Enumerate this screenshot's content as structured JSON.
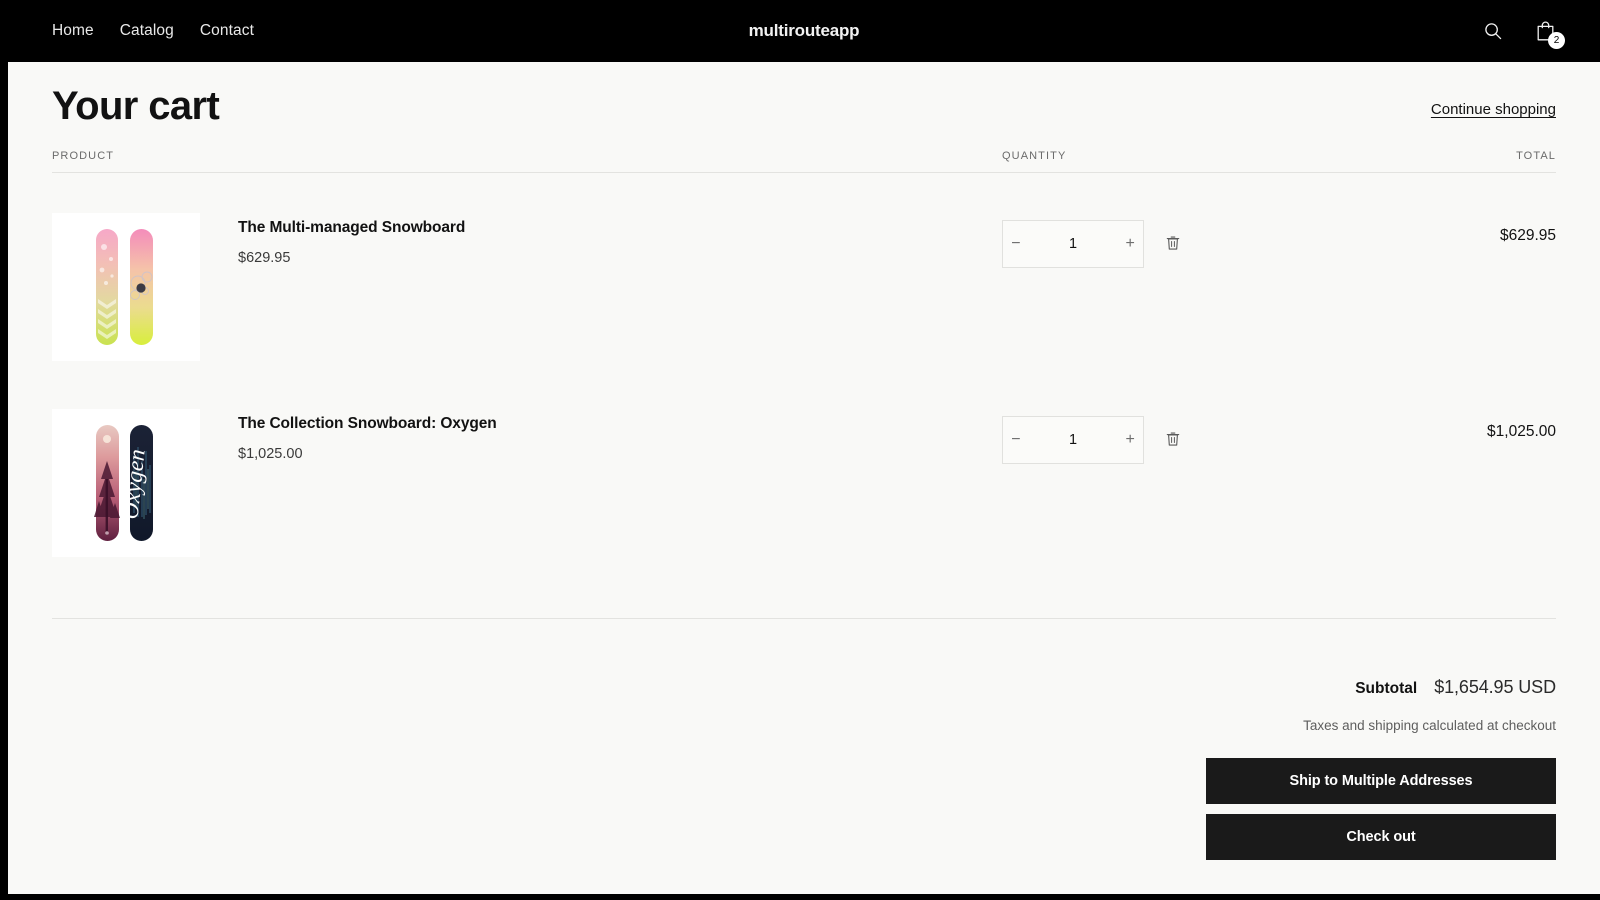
{
  "header": {
    "nav": [
      {
        "label": "Home",
        "name": "nav-link-home"
      },
      {
        "label": "Catalog",
        "name": "nav-link-catalog"
      },
      {
        "label": "Contact",
        "name": "nav-link-contact"
      }
    ],
    "brand": "multirouteapp",
    "search_icon": "search-icon",
    "cart_icon": "shopping-bag-icon",
    "cart_count": "2",
    "background_color": "#000000"
  },
  "cart": {
    "title": "Your cart",
    "continue_shopping": "Continue shopping",
    "columns": {
      "product": "PRODUCT",
      "quantity": "QUANTITY",
      "total": "TOTAL"
    },
    "items": [
      {
        "name": "The Multi-managed Snowboard",
        "unit_price": "$629.95",
        "quantity": "1",
        "line_total": "$629.95",
        "decrease_label": "−",
        "increase_label": "+",
        "remove_icon": "trash-icon",
        "image_alt": "snowboard-pink-yellow"
      },
      {
        "name": "The Collection Snowboard: Oxygen",
        "unit_price": "$1,025.00",
        "quantity": "1",
        "line_total": "$1,025.00",
        "decrease_label": "−",
        "increase_label": "+",
        "remove_icon": "trash-icon",
        "image_alt": "snowboard-oxygen-navy"
      }
    ],
    "summary": {
      "subtotal_label": "Subtotal",
      "subtotal_value": "$1,654.95 USD",
      "tax_note": "Taxes and shipping calculated at checkout",
      "ship_multiple_label": "Ship to Multiple Addresses",
      "checkout_label": "Check out",
      "button_color": "#1a1a1a"
    }
  },
  "theme": {
    "page_background": "#f9f9f7",
    "text_color": "#121212",
    "muted_text": "#6b6b6b",
    "divider": "#e3e3e0"
  }
}
